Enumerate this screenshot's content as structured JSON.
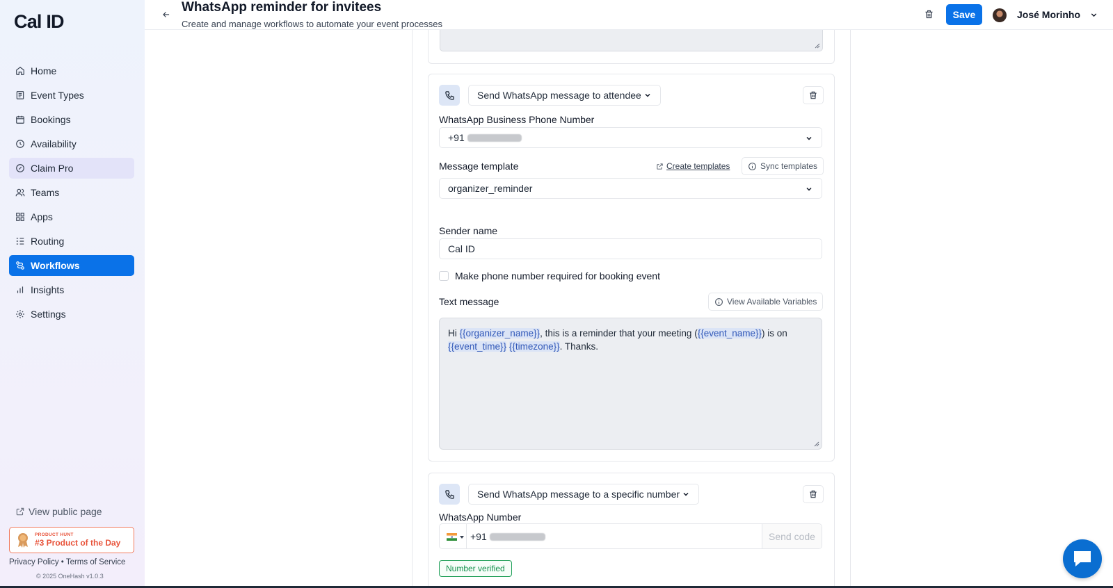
{
  "app": {
    "logo": "Cal ID"
  },
  "sidebar": {
    "items": [
      {
        "label": "Home",
        "icon": "home-icon"
      },
      {
        "label": "Event Types",
        "icon": "event-types-icon"
      },
      {
        "label": "Bookings",
        "icon": "calendar-icon"
      },
      {
        "label": "Availability",
        "icon": "clock-icon"
      },
      {
        "label": "Claim Pro",
        "icon": "pro-icon"
      },
      {
        "label": "Teams",
        "icon": "users-icon"
      },
      {
        "label": "Apps",
        "icon": "grid-icon"
      },
      {
        "label": "Routing",
        "icon": "routing-icon"
      },
      {
        "label": "Workflows",
        "icon": "workflows-icon",
        "active": true
      },
      {
        "label": "Insights",
        "icon": "chart-icon"
      },
      {
        "label": "Settings",
        "icon": "gear-icon"
      }
    ],
    "view_public_page": "View public page",
    "product_hunt_top": "PRODUCT HUNT",
    "product_hunt_main": "#3 Product of the Day",
    "privacy_policy": "Privacy Policy",
    "bullet": "•",
    "terms": "Terms of Service",
    "copyright": "© 2025 OneHash v1.0.3"
  },
  "header": {
    "title": "WhatsApp reminder for invitees",
    "subtitle": "Create and manage workflows to automate your event processes",
    "save_label": "Save",
    "user_name": "José Morinho"
  },
  "step1": {
    "action": "Send WhatsApp message to attendee",
    "phone_label": "WhatsApp Business Phone Number",
    "phone_prefix": "+91",
    "template_label": "Message template",
    "create_templates": "Create templates",
    "sync_templates": "Sync templates",
    "template_value": "organizer_reminder",
    "sender_label": "Sender name",
    "sender_value": "Cal ID",
    "checkbox_label": "Make phone number required for booking event",
    "text_label": "Text message",
    "view_variables": "View Available Variables",
    "message": {
      "p1": "Hi ",
      "v1": "{{organizer_name}}",
      "p2": ", this is a reminder that your meeting (",
      "v2": "{{event_name}}",
      "p3": ") is on ",
      "v3": "{{event_time}}",
      "p4": " ",
      "v4": "{{timezone}}",
      "p5": ". Thanks."
    }
  },
  "step2": {
    "action": "Send WhatsApp message to a specific number",
    "number_label": "WhatsApp Number",
    "phone_prefix": "+91",
    "send_code": "Send code",
    "verified": "Number verified"
  },
  "colors": {
    "primary": "#0a72e8",
    "verified": "#22a05a",
    "product_hunt": "#e8533a"
  }
}
